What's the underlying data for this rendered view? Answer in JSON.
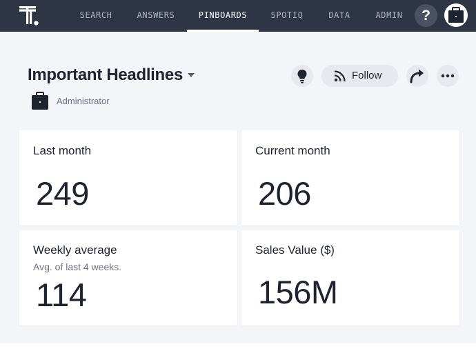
{
  "nav": {
    "items": [
      {
        "label": "SEARCH",
        "active": false
      },
      {
        "label": "ANSWERS",
        "active": false
      },
      {
        "label": "PINBOARDS",
        "active": true
      },
      {
        "label": "SPOTIQ",
        "active": false
      },
      {
        "label": "DATA",
        "active": false
      },
      {
        "label": "ADMIN",
        "active": false
      }
    ],
    "help_label": "?"
  },
  "pinboard": {
    "title": "Important Headlines",
    "author": "Administrator",
    "follow_label": "Follow"
  },
  "cards": [
    {
      "title": "Last month",
      "subtitle": "",
      "value": "249"
    },
    {
      "title": "Current month",
      "subtitle": "",
      "value": "206"
    },
    {
      "title": "Weekly average",
      "subtitle": "Avg. of last 4 weeks.",
      "value": "114"
    },
    {
      "title": "Sales Value ($)",
      "subtitle": "",
      "value": "156M"
    }
  ],
  "icons": {
    "logo": "thoughtspot-logo",
    "help": "question-mark-icon",
    "avatar": "briefcase-icon",
    "caret": "caret-down-icon",
    "insight": "lightbulb-icon",
    "follow": "rss-feed-icon",
    "share": "share-arrow-icon",
    "more": "more-dots-icon"
  },
  "colors": {
    "nav_bg": "#2e3645",
    "page_bg": "#f3f5f9",
    "card_bg": "#ffffff",
    "text": "#1d232f",
    "muted_text": "#6b7280"
  }
}
